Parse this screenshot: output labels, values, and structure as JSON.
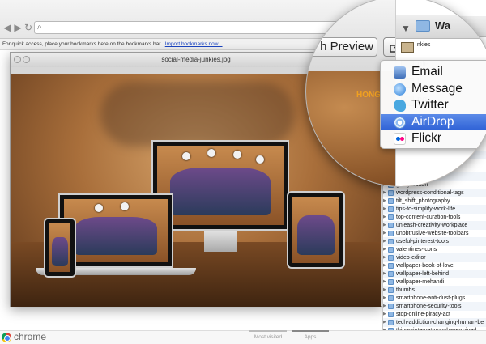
{
  "browser": {
    "bookmark_bar_text": "For quick access, place your bookmarks here on the bookmarks bar.",
    "bookmark_bar_link": "Import bookmarks now...",
    "brand": "chrome",
    "ntp_tabs": [
      "Most visited",
      "Apps"
    ]
  },
  "preview": {
    "file_name": "social-media-junkies.jpg"
  },
  "magnifier": {
    "share_button_partial_label": "h Preview",
    "folder_name_partial": "Wa",
    "image_text_partial": "HONG",
    "sidebar_partial_rows": [
      "nkies",
      "ple",
      "ll",
      "ng"
    ]
  },
  "share_menu": {
    "items": [
      {
        "label": "Email",
        "icon": "email-icon",
        "selected": false
      },
      {
        "label": "Message",
        "icon": "message-icon",
        "selected": false
      },
      {
        "label": "Twitter",
        "icon": "twitter-icon",
        "selected": false
      },
      {
        "label": "AirDrop",
        "icon": "airdrop-icon",
        "selected": true
      },
      {
        "label": "Flickr",
        "icon": "flickr-icon",
        "selected": false
      }
    ]
  },
  "file_list": {
    "partial_rows": [
      "zip",
      "ZI",
      "ip"
    ],
    "items": [
      "-mobile",
      "rformance_tips",
      "g-buy-button",
      "wordpress-conditional-tags",
      "tilt_shift_photography",
      "tips-to-simplify-work-life",
      "top-content-curation-tools",
      "unleash-creativity-workplace",
      "unobtrusive-website-toolbars",
      "useful-pinterest-tools",
      "valentines-icons",
      "video-editor",
      "wallpaper-book-of-love",
      "wallpaper-left-behind",
      "wallpaper-mehandi",
      "thumbs",
      "smartphone-anti-dust-plugs",
      "smartphone-security-tools",
      "stop-online-piracy-act",
      "tech-addiction-changing-human-be",
      "things-internet-may-have-ruined",
      "things-shouldnt-be-on-facebook"
    ]
  }
}
